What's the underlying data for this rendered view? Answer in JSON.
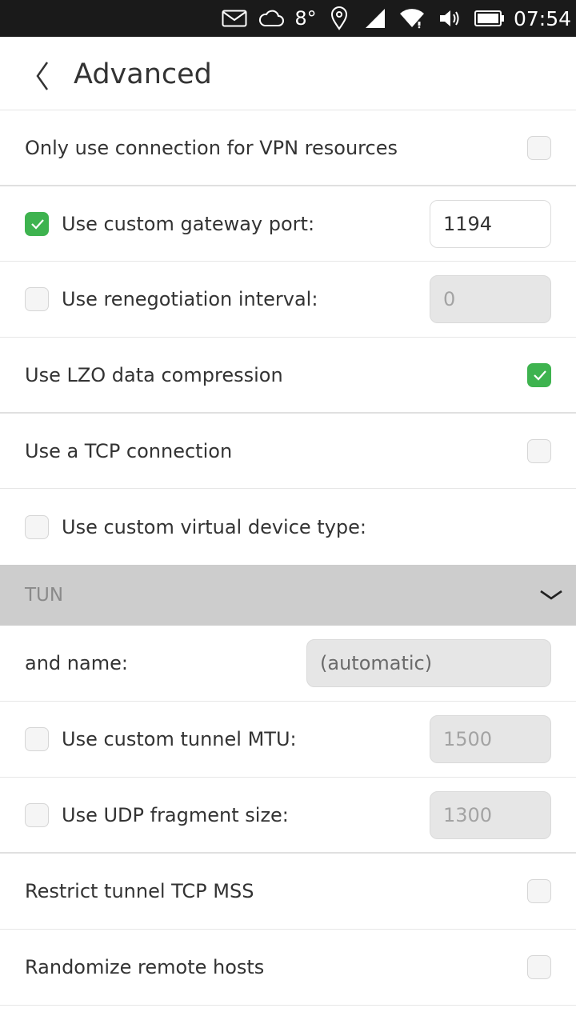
{
  "status_bar": {
    "temperature": "8°",
    "time": "07:54",
    "icons": [
      "message-icon",
      "cloud-icon",
      "location-icon",
      "cellular-signal-icon",
      "wifi-icon",
      "volume-icon",
      "battery-icon"
    ]
  },
  "header": {
    "title": "Advanced",
    "back_icon": "chevron-left-icon"
  },
  "settings": {
    "vpn_only": {
      "label": "Only use connection for VPN resources",
      "checked": false
    },
    "gateway_port": {
      "label": "Use custom gateway port:",
      "checked": true,
      "value": "1194"
    },
    "renegotiation": {
      "label": "Use renegotiation interval:",
      "checked": false,
      "value": "0"
    },
    "lzo": {
      "label": "Use LZO data compression",
      "checked": true
    },
    "tcp": {
      "label": "Use a TCP connection",
      "checked": false
    },
    "device_type": {
      "label": "Use custom virtual device type:",
      "checked": false
    },
    "device_type_select": {
      "value": "TUN",
      "icon": "chevron-down-icon"
    },
    "device_name": {
      "label": "and name:",
      "value": "(automatic)"
    },
    "tunnel_mtu": {
      "label": "Use custom tunnel MTU:",
      "checked": false,
      "value": "1500"
    },
    "udp_fragment": {
      "label": "Use UDP fragment size:",
      "checked": false,
      "value": "1300"
    },
    "restrict_mss": {
      "label": "Restrict tunnel TCP MSS",
      "checked": false
    },
    "randomize_hosts": {
      "label": "Randomize remote hosts",
      "checked": false
    }
  },
  "colors": {
    "accent": "#3eb34f",
    "status_bar": "#1a1a1a",
    "dropdown_bg": "#cdcdcd"
  }
}
